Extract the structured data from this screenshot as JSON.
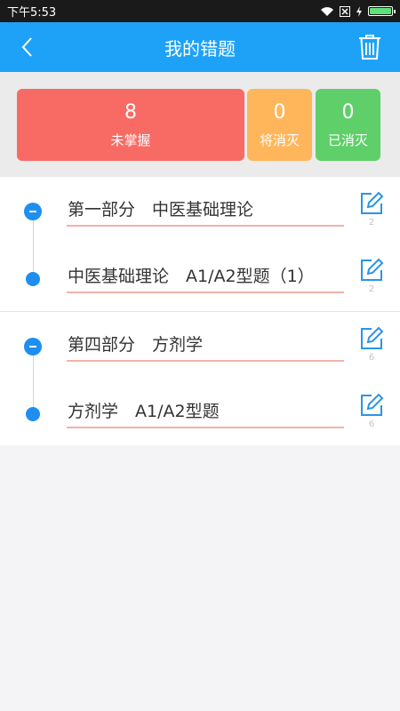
{
  "status_bar": {
    "time": "下午5:53"
  },
  "header": {
    "title": "我的错题"
  },
  "stats": {
    "unmastered": {
      "value": "8",
      "label": "未掌握"
    },
    "pending": {
      "value": "0",
      "label": "将消灭"
    },
    "eliminated": {
      "value": "0",
      "label": "已消灭"
    }
  },
  "groups": [
    {
      "title": "第一部分　中医基础理论",
      "count": "2",
      "child": {
        "title": "中医基础理论　A1/A2型题（1）",
        "count": "2"
      }
    },
    {
      "title": "第四部分　方剂学",
      "count": "6",
      "child": {
        "title": "方剂学　A1/A2型题",
        "count": "6"
      }
    }
  ],
  "colors": {
    "header": "#1ea2f8",
    "unmastered": "#f76b64",
    "pending": "#ffb65b",
    "eliminated": "#5fcf69",
    "accent": "#1e8ff0"
  }
}
